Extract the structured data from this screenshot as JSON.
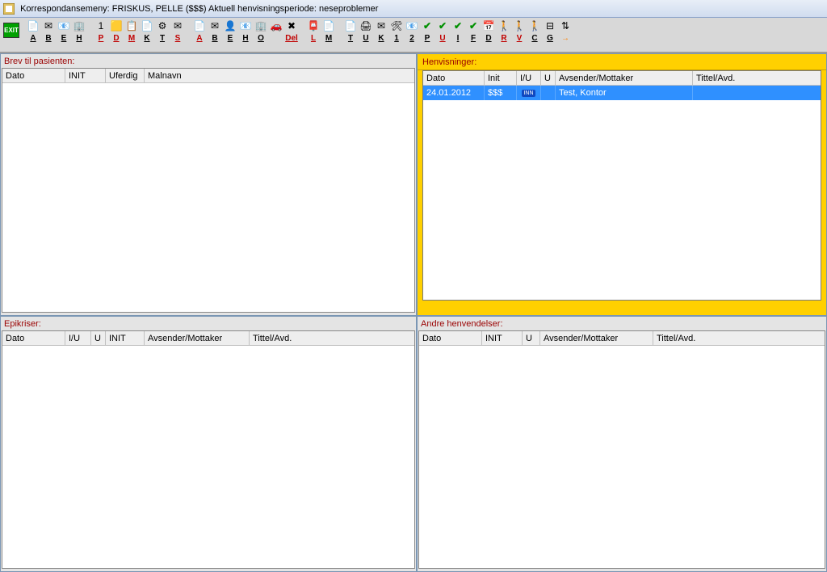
{
  "title": "Korrespondansemeny: FRISKUS, PELLE ($$$)   Aktuell henvisningsperiode: neseproblemer",
  "exit": "EXIT",
  "toolbar": [
    {
      "ic": "📄",
      "lb": "A",
      "c": "black"
    },
    {
      "ic": "✉",
      "lb": "B",
      "c": "black"
    },
    {
      "ic": "📧",
      "lb": "E",
      "c": "black"
    },
    {
      "ic": "🏢",
      "lb": "H",
      "c": "black"
    },
    {
      "ic": "",
      "lb": "",
      "c": ""
    },
    {
      "ic": "1",
      "lb": "P",
      "c": "red"
    },
    {
      "ic": "🟨",
      "lb": "D",
      "c": "red"
    },
    {
      "ic": "📋",
      "lb": "M",
      "c": "red"
    },
    {
      "ic": "📄",
      "lb": "K",
      "c": "black"
    },
    {
      "ic": "⚙",
      "lb": "T",
      "c": "black"
    },
    {
      "ic": "✉",
      "lb": "S",
      "c": "red"
    },
    {
      "ic": "",
      "lb": "",
      "c": ""
    },
    {
      "ic": "📄",
      "lb": "A",
      "c": "red"
    },
    {
      "ic": "✉",
      "lb": "B",
      "c": "black"
    },
    {
      "ic": "👤",
      "lb": "E",
      "c": "black"
    },
    {
      "ic": "📧",
      "lb": "H",
      "c": "black"
    },
    {
      "ic": "🏢",
      "lb": "O",
      "c": "black"
    },
    {
      "ic": "🚗",
      "lb": "",
      "c": ""
    },
    {
      "ic": "✖",
      "lb": "Del",
      "c": "red"
    },
    {
      "ic": "",
      "lb": "",
      "c": ""
    },
    {
      "ic": "📮",
      "lb": "L",
      "c": "red"
    },
    {
      "ic": "📄",
      "lb": "M",
      "c": "black"
    },
    {
      "ic": "",
      "lb": "",
      "c": ""
    },
    {
      "ic": "📄",
      "lb": "T",
      "c": "black"
    },
    {
      "ic": "🖨",
      "lb": "U",
      "c": "black"
    },
    {
      "ic": "✉",
      "lb": "K",
      "c": "black"
    },
    {
      "ic": "🛠",
      "lb": "1",
      "c": "black"
    },
    {
      "ic": "📧",
      "lb": "2",
      "c": "black"
    },
    {
      "ic": "✔",
      "lb": "P",
      "c": "black",
      "check": true
    },
    {
      "ic": "✔",
      "lb": "U",
      "c": "red",
      "check": true
    },
    {
      "ic": "✔",
      "lb": "I",
      "c": "black",
      "check": true
    },
    {
      "ic": "✔",
      "lb": "F",
      "c": "black",
      "check": true
    },
    {
      "ic": "📅",
      "lb": "D",
      "c": "black"
    },
    {
      "ic": "🚶",
      "lb": "R",
      "c": "red"
    },
    {
      "ic": "🚶",
      "lb": "V",
      "c": "red"
    },
    {
      "ic": "🚶",
      "lb": "C",
      "c": "black"
    },
    {
      "ic": "⊟",
      "lb": "G",
      "c": "black"
    },
    {
      "ic": "⇅",
      "lb": "→",
      "c": "arrow"
    }
  ],
  "panels": {
    "brev": {
      "title": "Brev til pasienten:",
      "cols": [
        "Dato",
        "INIT",
        "Uferdig",
        "Malnavn"
      ]
    },
    "henv": {
      "title": "Henvisninger:",
      "cols": [
        "Dato",
        "Init",
        "I/U",
        "U",
        "Avsender/Mottaker",
        "Tittel/Avd."
      ],
      "row": {
        "dato": "24.01.2012",
        "init": "$$$",
        "iu": "INN",
        "u": "",
        "avs": "Test, Kontor",
        "tit": ""
      }
    },
    "epik": {
      "title": "Epikriser:",
      "cols": [
        "Dato",
        "I/U",
        "U",
        "INIT",
        "Avsender/Mottaker",
        "Tittel/Avd."
      ]
    },
    "andre": {
      "title": "Andre henvendelser:",
      "cols": [
        "Dato",
        "INIT",
        "U",
        "Avsender/Mottaker",
        "Tittel/Avd."
      ]
    }
  }
}
